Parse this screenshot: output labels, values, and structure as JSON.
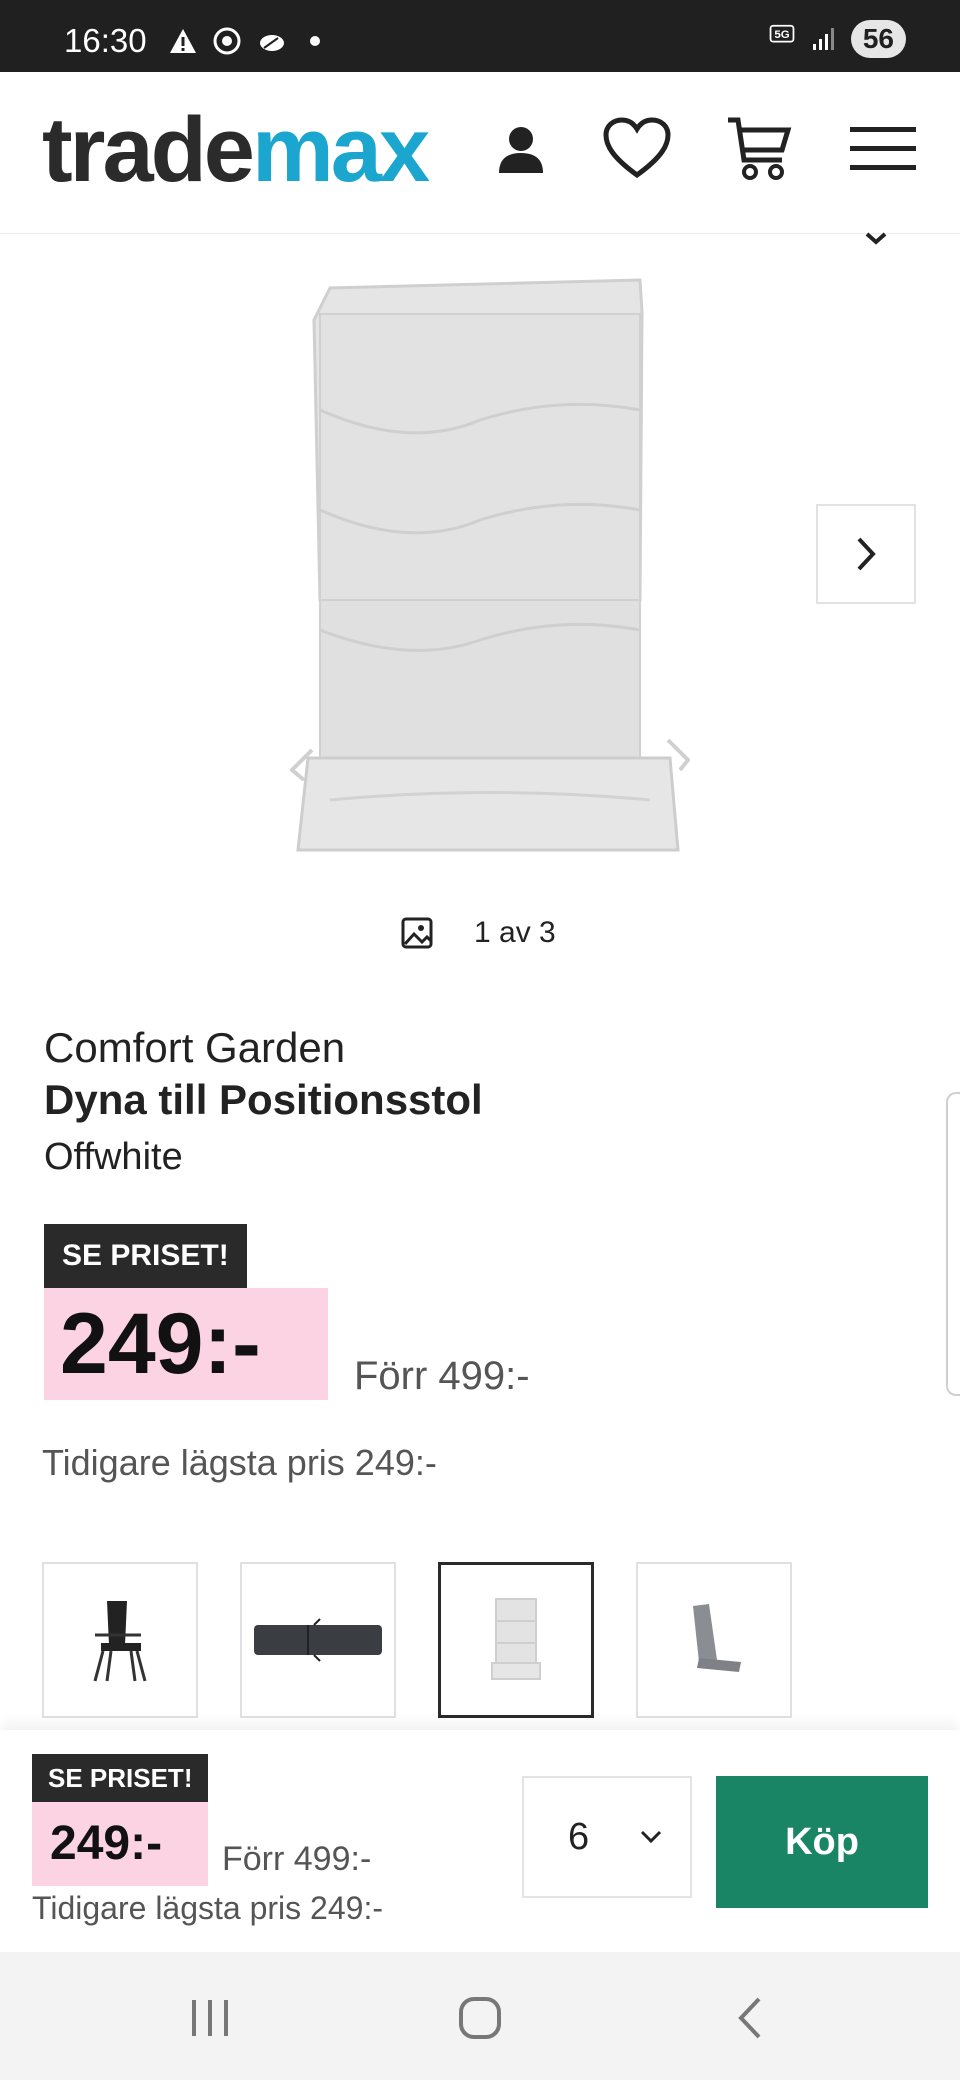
{
  "status_bar": {
    "time": "16:30",
    "battery": "56",
    "network": "5G",
    "icons_left": [
      "warning-icon",
      "chrome-icon",
      "cloud-icon",
      "dot-icon"
    ],
    "icons_right": [
      "5g-icon",
      "signal-icon",
      "battery-icon"
    ]
  },
  "header": {
    "logo_part1": "trade",
    "logo_part2": "max",
    "icons": [
      "account-icon",
      "heart-icon",
      "cart-icon",
      "menu-icon"
    ]
  },
  "gallery": {
    "counter": "1 av 3",
    "colors": {
      "cushion": "#e4e4e4",
      "cushion_shadow": "#cfcfcf"
    }
  },
  "product": {
    "brand": "Comfort Garden",
    "name": "Dyna till Positionsstol",
    "variant": "Offwhite",
    "badge": "SE PRISET!",
    "price": "249:-",
    "was_price": "Förr 499:-",
    "lowest_price": "Tidigare lägsta pris 249:-"
  },
  "thumbnails": [
    {
      "name": "thumb-black-chair"
    },
    {
      "name": "thumb-dark-cushion"
    },
    {
      "name": "thumb-offwhite-cushion",
      "selected": true
    },
    {
      "name": "thumb-grey-cushion"
    }
  ],
  "sticky": {
    "badge": "SE PRISET!",
    "price": "249:-",
    "was_price": "Förr 499:-",
    "lowest_price": "Tidigare lägsta pris 249:-",
    "quantity": "6",
    "buy_label": "Köp"
  },
  "colors": {
    "accent_teal": "#1ba6cf",
    "buy_green": "#198564",
    "price_pink": "#fcd3e3",
    "badge_dark": "#2a2a2a"
  }
}
